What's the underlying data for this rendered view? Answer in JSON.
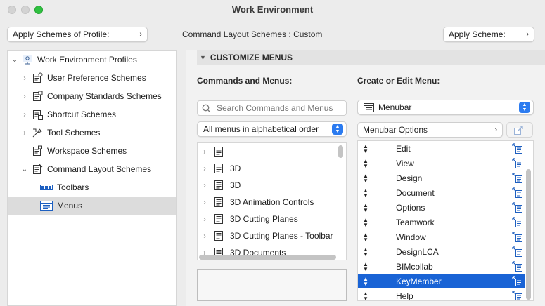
{
  "window": {
    "title": "Work Environment"
  },
  "toolbar": {
    "apply_profile_label": "Apply Schemes of Profile:",
    "scheme_caption": "Command Layout Schemes :  Custom",
    "apply_scheme_label": "Apply Scheme:"
  },
  "tree": {
    "items": [
      {
        "label": "Work Environment Profiles",
        "icon": "profiles-icon",
        "expanded": true
      },
      {
        "label": "User Preference Schemes",
        "icon": "user-preference-icon"
      },
      {
        "label": "Company Standards Schemes",
        "icon": "company-standards-icon"
      },
      {
        "label": "Shortcut Schemes",
        "icon": "shortcut-icon"
      },
      {
        "label": "Tool Schemes",
        "icon": "tool-icon"
      },
      {
        "label": "Workspace Schemes",
        "icon": "workspace-icon"
      },
      {
        "label": "Command Layout Schemes",
        "icon": "command-layout-icon",
        "expanded": true
      },
      {
        "label": "Toolbars",
        "icon": "toolbars-icon"
      },
      {
        "label": "Menus",
        "icon": "menus-icon",
        "selected": true
      }
    ]
  },
  "customize": {
    "header": "CUSTOMIZE MENUS",
    "commands_heading": "Commands and Menus:",
    "edit_heading": "Create or Edit Menu:",
    "search_placeholder": "Search Commands and Menus",
    "filter_value": "All menus in alphabetical order",
    "menu_select_value": "Menubar",
    "menubar_options_label": "Menubar Options"
  },
  "commands": [
    {
      "label": ""
    },
    {
      "label": "3D"
    },
    {
      "label": "3D"
    },
    {
      "label": "3D Animation Controls"
    },
    {
      "label": "3D Cutting Planes"
    },
    {
      "label": "3D Cutting Planes - Toolbar"
    },
    {
      "label": "3D Documents"
    }
  ],
  "menus": [
    {
      "label": "Edit"
    },
    {
      "label": "View"
    },
    {
      "label": "Design"
    },
    {
      "label": "Document"
    },
    {
      "label": "Options"
    },
    {
      "label": "Teamwork"
    },
    {
      "label": "Window"
    },
    {
      "label": "DesignLCA"
    },
    {
      "label": "BIMcollab"
    },
    {
      "label": "KeyMember",
      "selected": true
    },
    {
      "label": "Help"
    }
  ],
  "colors": {
    "accent": "#2b7bf0",
    "selection": "#1963d5",
    "close_light": "#d3d3d3",
    "zoom_light": "#2fc140"
  }
}
